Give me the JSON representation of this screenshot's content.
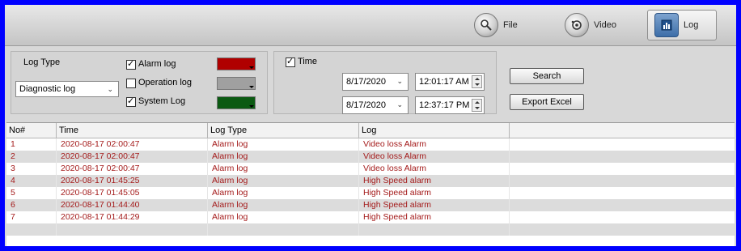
{
  "nav": [
    {
      "label": "File",
      "icon": "file-disc-icon",
      "active": false
    },
    {
      "label": "Video",
      "icon": "video-disc-icon",
      "active": false
    },
    {
      "label": "Log",
      "icon": "log-icon",
      "active": true
    }
  ],
  "filters": {
    "log_type_label": "Log Type",
    "log_type_selected": "Diagnostic log",
    "checks": [
      {
        "label": "Alarm log",
        "checked": true,
        "color": "#b00000"
      },
      {
        "label": "Operation log",
        "checked": false,
        "color": "#a0a0a0"
      },
      {
        "label": "System Log",
        "checked": true,
        "color": "#0b5a12"
      }
    ],
    "time_label": "Time",
    "time_checked": true,
    "start_date": "8/17/2020",
    "start_time": "12:01:17 AM",
    "end_date": "8/17/2020",
    "end_time": "12:37:17 PM"
  },
  "actions": {
    "search": "Search",
    "export": "Export Excel"
  },
  "table": {
    "columns": [
      "No#",
      "Time",
      "Log Type",
      "Log"
    ],
    "rows": [
      {
        "no": "1",
        "time": "2020-08-17 02:00:47",
        "type": "Alarm log",
        "log": "Video loss Alarm"
      },
      {
        "no": "2",
        "time": "2020-08-17 02:00:47",
        "type": "Alarm log",
        "log": "Video loss Alarm"
      },
      {
        "no": "3",
        "time": "2020-08-17 02:00:47",
        "type": "Alarm log",
        "log": "Video loss Alarm"
      },
      {
        "no": "4",
        "time": "2020-08-17 01:45:25",
        "type": "Alarm log",
        "log": "High Speed alarm"
      },
      {
        "no": "5",
        "time": "2020-08-17 01:45:05",
        "type": "Alarm log",
        "log": "High Speed alarm"
      },
      {
        "no": "6",
        "time": "2020-08-17 01:44:40",
        "type": "Alarm log",
        "log": "High Speed alarm"
      },
      {
        "no": "7",
        "time": "2020-08-17 01:44:29",
        "type": "Alarm log",
        "log": "High Speed alarm"
      }
    ]
  },
  "colors": {
    "frame": "#0000ff",
    "row_text": "#a41a1a"
  }
}
